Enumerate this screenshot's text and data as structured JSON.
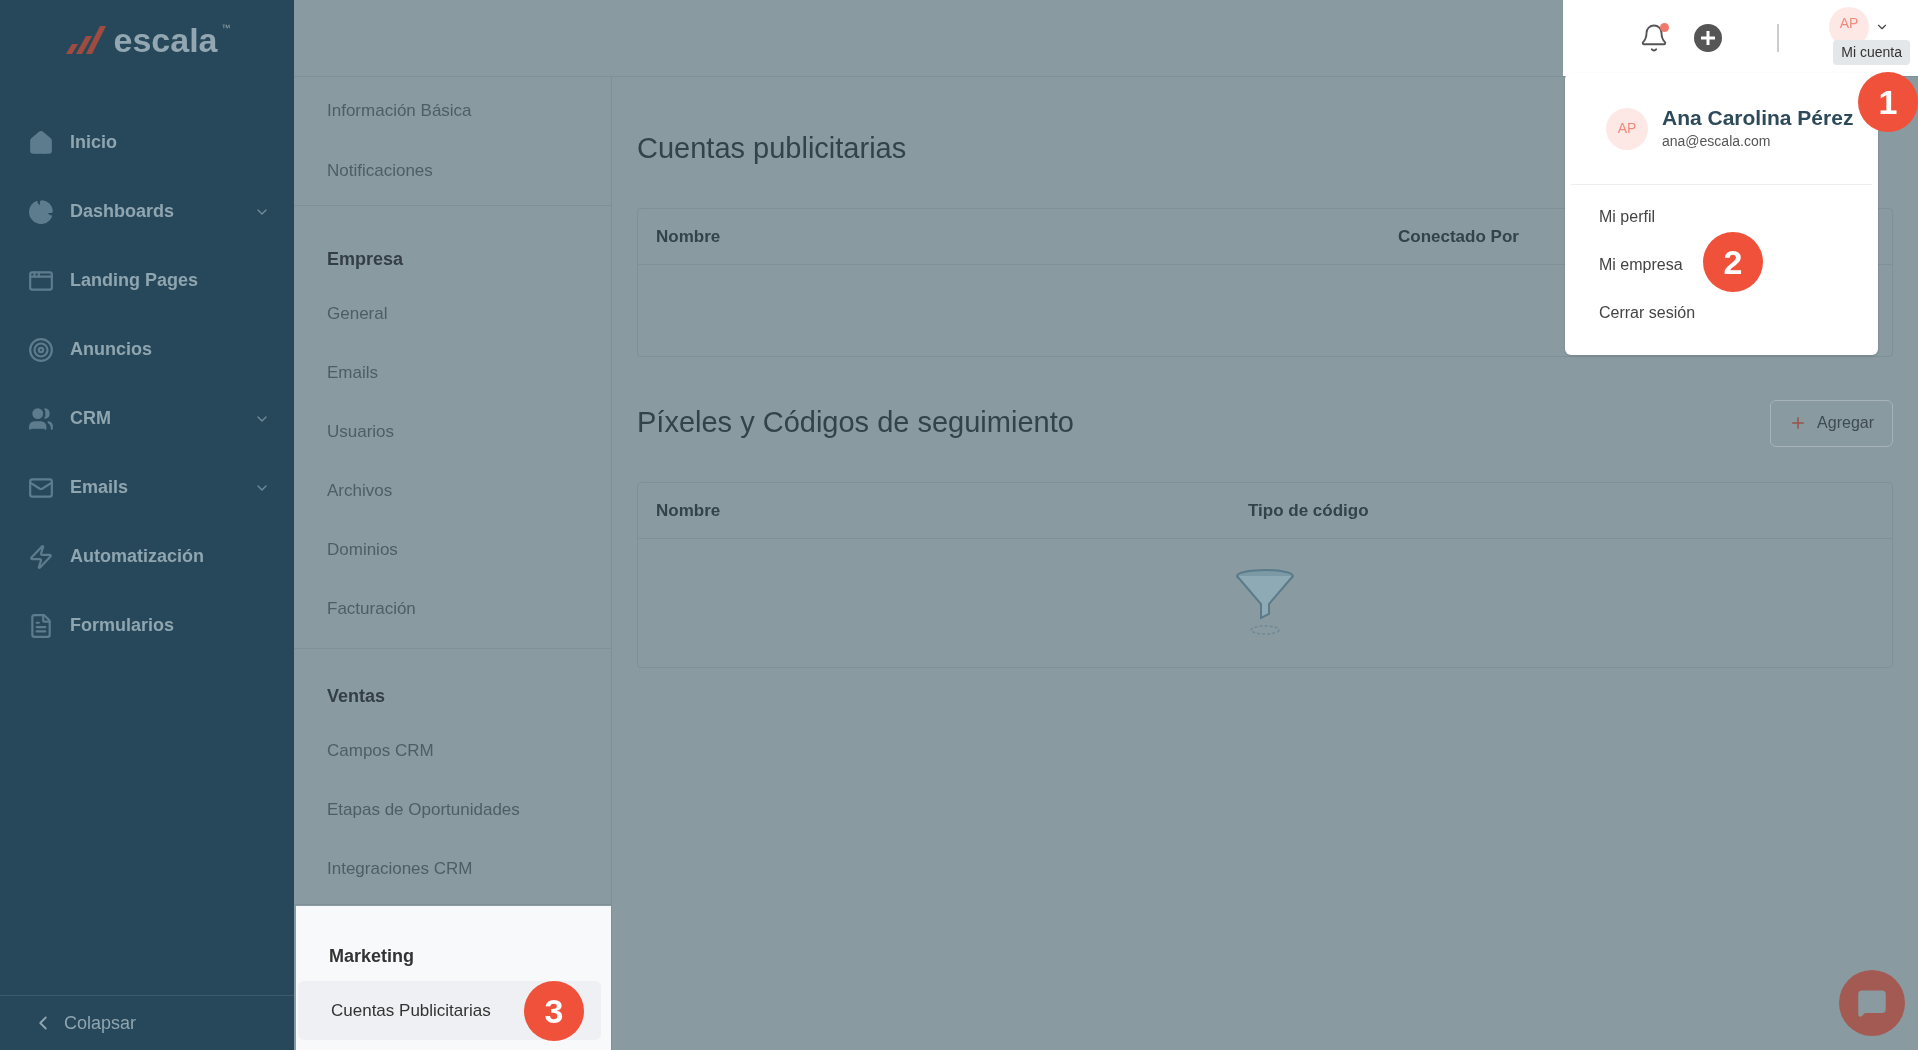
{
  "sidebar": {
    "logo": {
      "name": "escala",
      "mark": "™"
    },
    "items": [
      {
        "label": "Inicio",
        "expandable": false
      },
      {
        "label": "Dashboards",
        "expandable": true
      },
      {
        "label": "Landing Pages",
        "expandable": false
      },
      {
        "label": "Anuncios",
        "expandable": false
      },
      {
        "label": "CRM",
        "expandable": true
      },
      {
        "label": "Emails",
        "expandable": true
      },
      {
        "label": "Automatización",
        "expandable": false
      },
      {
        "label": "Formularios",
        "expandable": false
      }
    ],
    "collapse": "Colapsar"
  },
  "header": {
    "notification": true,
    "avatar": "AP",
    "tooltip": "Mi cuenta"
  },
  "settings_nav": [
    {
      "highlighted": false,
      "items": [
        {
          "label": "Información Básica",
          "selected": false
        },
        {
          "label": "Notificaciones",
          "selected": false
        }
      ]
    },
    {
      "title": "Empresa",
      "highlighted": false,
      "items": [
        {
          "label": "General",
          "selected": false
        },
        {
          "label": "Emails",
          "selected": false
        },
        {
          "label": "Usuarios",
          "selected": false
        },
        {
          "label": "Archivos",
          "selected": false
        },
        {
          "label": "Dominios",
          "selected": false
        },
        {
          "label": "Facturación",
          "selected": false
        }
      ]
    },
    {
      "title": "Ventas",
      "highlighted": false,
      "items": [
        {
          "label": "Campos CRM",
          "selected": false
        },
        {
          "label": "Etapas de Oportunidades",
          "selected": false
        },
        {
          "label": "Integraciones CRM",
          "selected": false
        }
      ]
    },
    {
      "title": "Marketing",
      "highlighted": true,
      "items": [
        {
          "label": "Cuentas Publicitarias",
          "selected": true
        }
      ]
    }
  ],
  "content": [
    {
      "title": "Cuentas publicitarias",
      "columns": [
        "Nombre",
        "Conectado Por"
      ],
      "empty": false
    },
    {
      "title": "Píxeles y Códigos de seguimiento",
      "button": "Agregar",
      "columns": [
        "Nombre",
        "Tipo de código"
      ],
      "empty": true
    }
  ],
  "account_menu": {
    "avatar": "AP",
    "name": "Ana Carolina Pérez",
    "email": "ana@escala.com",
    "items": [
      "Mi perfil",
      "Mi empresa",
      "Cerrar sesión"
    ]
  },
  "callouts": [
    "1",
    "2",
    "3"
  ]
}
